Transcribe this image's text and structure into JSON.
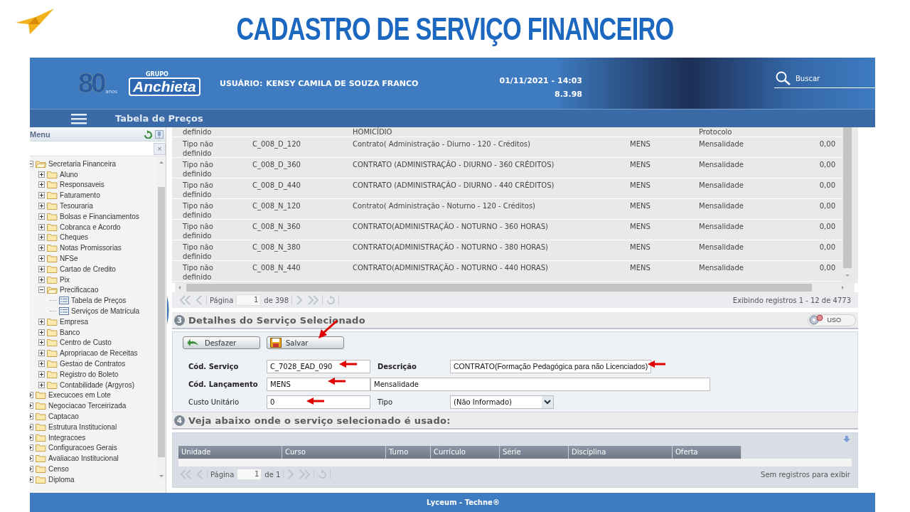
{
  "slide": {
    "title": "CADASTRO DE SERVIÇO FINANCEIRO"
  },
  "header": {
    "logo_number": "80",
    "logo_caption": "anos",
    "brand_small": "GRUPO",
    "brand": "Anchieta",
    "user_label": "USUÁRIO:",
    "user_name": "KENSY CAMILA DE SOUZA FRANCO",
    "datetime": "01/11/2021 - 14:03",
    "version": "8.3.98",
    "search_label": "Buscar"
  },
  "page_bar": {
    "title": "Tabela de Preços"
  },
  "sidebar": {
    "title": "Menu",
    "clear": "×",
    "items": [
      {
        "kind": "folder",
        "label": "Secretaria Financeira",
        "expanded": true,
        "children": [
          {
            "kind": "folder",
            "label": "Aluno",
            "expanded": false
          },
          {
            "kind": "folder",
            "label": "Responsaveis",
            "expanded": false
          },
          {
            "kind": "folder",
            "label": "Faturamento",
            "expanded": false
          },
          {
            "kind": "folder",
            "label": "Tesouraria",
            "expanded": false
          },
          {
            "kind": "folder",
            "label": "Bolsas e Financiamentos",
            "expanded": false
          },
          {
            "kind": "folder",
            "label": "Cobranca e Acordo",
            "expanded": false
          },
          {
            "kind": "folder",
            "label": "Cheques",
            "expanded": false
          },
          {
            "kind": "folder",
            "label": "Notas Promissorias",
            "expanded": false
          },
          {
            "kind": "folder",
            "label": "NFSe",
            "expanded": false
          },
          {
            "kind": "folder",
            "label": "Cartao de Credito",
            "expanded": false
          },
          {
            "kind": "folder",
            "label": "Pix",
            "expanded": false
          },
          {
            "kind": "folder",
            "label": "Precificacao",
            "expanded": true,
            "children": [
              {
                "kind": "page",
                "label": "Tabela de Preços"
              },
              {
                "kind": "page",
                "label": "Serviços de Matrícula"
              }
            ]
          },
          {
            "kind": "folder",
            "label": "Empresa",
            "expanded": false
          },
          {
            "kind": "folder",
            "label": "Banco",
            "expanded": false
          },
          {
            "kind": "folder",
            "label": "Centro de Custo",
            "expanded": false
          },
          {
            "kind": "folder",
            "label": "Apropriacao de Receitas",
            "expanded": false
          },
          {
            "kind": "folder",
            "label": "Gestao de Contratos",
            "expanded": false
          },
          {
            "kind": "folder",
            "label": "Registro do Boleto",
            "expanded": false
          },
          {
            "kind": "folder",
            "label": "Contabilidade (Argyros)",
            "expanded": false
          }
        ]
      },
      {
        "kind": "folder",
        "label": "Execucoes em Lote",
        "expanded": false
      },
      {
        "kind": "folder",
        "label": "Negociacao Terceirizada",
        "expanded": false
      },
      {
        "kind": "folder",
        "label": "Captacao",
        "expanded": false
      },
      {
        "kind": "folder",
        "label": "Estrutura Institucional",
        "expanded": false
      },
      {
        "kind": "folder",
        "label": "Integracoes",
        "expanded": false
      },
      {
        "kind": "folder",
        "label": "Configuracoes Gerais",
        "expanded": false
      },
      {
        "kind": "folder",
        "label": "Avaliacao Institucional",
        "expanded": false
      },
      {
        "kind": "folder",
        "label": "Censo",
        "expanded": false
      },
      {
        "kind": "folder",
        "label": "Diploma",
        "expanded": false
      }
    ]
  },
  "table": {
    "rows": [
      {
        "column_1": "definido",
        "column_3": "HOMICÍDIO",
        "column_5": "Protocolo"
      },
      {
        "column_1": "Tipo não definido",
        "column_2": "C_008_D_120",
        "column_3": "Contrato(  Administração - Diurno - 120 - Créditos)",
        "column_4": "MENS",
        "column_5": "Mensalidade",
        "column_6": "0,00"
      },
      {
        "column_1": "Tipo não definido",
        "column_2": "C_008_D_360",
        "column_3": "CONTRATO (ADMINISTRAÇÃO - DIURNO - 360 CRÉDITOS)",
        "column_4": "MENS",
        "column_5": "Mensalidade",
        "column_6": "0,00"
      },
      {
        "column_1": "Tipo não definido",
        "column_2": "C_008_D_440",
        "column_3": "CONTRATO (ADMINISTRAÇÃO - DIURNO - 440 CRÉDITOS)",
        "column_4": "MENS",
        "column_5": "Mensalidade",
        "column_6": "0,00"
      },
      {
        "column_1": "Tipo não definido",
        "column_2": "C_008_N_120",
        "column_3": "Contrato(  Administração - Noturno - 120 - Créditos)",
        "column_4": "MENS",
        "column_5": "Mensalidade",
        "column_6": "0,00"
      },
      {
        "column_1": "Tipo não definido",
        "column_2": "C_008_N_360",
        "column_3": "CONTRATO(ADMINISTRAÇÃO - NOTURNO - 360 HORAS)",
        "column_4": "MENS",
        "column_5": "Mensalidade",
        "column_6": "0,00"
      },
      {
        "column_1": "Tipo não definido",
        "column_2": "C_008_N_380",
        "column_3": "CONTRATO(ADMINISTRAÇÃO - NOTURNO - 380 HORAS)",
        "column_4": "MENS",
        "column_5": "Mensalidade",
        "column_6": "0,00"
      },
      {
        "column_1": "Tipo não definido",
        "column_2": "C_008_N_440",
        "column_3": "CONTRATO(ADMINISTRAÇÃO - NOTURNO - 440 HORAS)",
        "column_4": "MENS",
        "column_5": "Mensalidade",
        "column_6": "0,00"
      }
    ],
    "pager": {
      "page_label": "Página",
      "page": "1",
      "of_pages": "de 398",
      "summary": "Exibindo registros 1 - 12 de 4773"
    }
  },
  "details": {
    "number": "3",
    "title": "Detalhes do Serviço Selecionado",
    "uso_button": "USO",
    "buttons": [
      {
        "kind": "undo",
        "label": "Desfazer"
      },
      {
        "kind": "save",
        "label": "Salvar"
      }
    ],
    "fields": [
      {
        "kind": "text",
        "label": "Cód. Serviço",
        "required": true,
        "value": "C_7028_EAD_090"
      },
      {
        "kind": "text",
        "label": "Descrição",
        "required": true,
        "value": "CONTRATO(Formação Pedagógica para não Licenciados)"
      },
      {
        "kind": "text",
        "label": "Cód. Lançamento",
        "required": true,
        "value": "MENS",
        "extra_value": "Mensalidade"
      },
      {
        "kind": "text",
        "label": "Custo Unitário",
        "required": false,
        "value": "0"
      },
      {
        "kind": "select",
        "label": "Tipo",
        "required": false,
        "value": "(Não Informado)"
      }
    ]
  },
  "usage": {
    "number": "4",
    "title": "Veja abaixo onde o serviço selecionado é usado:",
    "columns": [
      "Unidade",
      "Curso",
      "Turno",
      "Currículo",
      "Série",
      "Disciplina",
      "Oferta"
    ],
    "pager": {
      "page_label": "Página",
      "page": "1",
      "of_pages": "de 1",
      "summary": "Sem registros para exibir"
    }
  },
  "footer": {
    "text": "Lyceum - Techne®"
  }
}
